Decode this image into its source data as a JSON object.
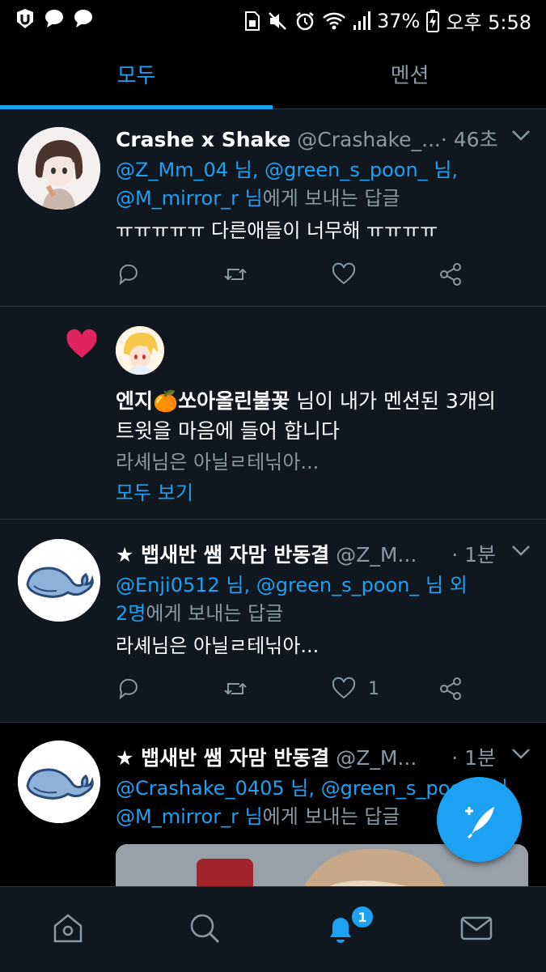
{
  "status_bar": {
    "battery": "37%",
    "time": "오후 5:58"
  },
  "tabs": [
    {
      "label": "모두"
    },
    {
      "label": "멘션"
    }
  ],
  "tweets": [
    {
      "name": "Crashe x Shake",
      "handle": "@Crashake_...",
      "time": "· 46초",
      "reply_to": {
        "line1": "@Z_Mm_04 님, @green_s_poon_ 님,",
        "line2_mention": "@M_mirror_r 님",
        "line2_rest": "에게 보내는 답글"
      },
      "text": "ㅠㅠㅠㅠㅠ 다른애들이 너무해 ㅠㅠㅠㅠ",
      "like_count": ""
    },
    {
      "name": "★ 뱁새반 쌤 자맘 반동결",
      "handle": "@Z_M...",
      "time": "· 1분",
      "reply_to": {
        "line1": "@Enji0512 님, @green_s_poon_ 님 외",
        "line2_mention": "2명",
        "line2_rest": "에게 보내는 답글"
      },
      "text": "라셰님은 아닐ㄹ테닊아...",
      "like_count": "1"
    },
    {
      "name": "★ 뱁새반 쌤 자맘 반동결",
      "handle": "@Z_M...",
      "time": "· 1분",
      "reply_to": {
        "line1": "@Crashake_0405 님, @green_s_poon_ 님,",
        "line2_mention": "@M_mirror_r 님",
        "line2_rest": "에게 보내는 답글"
      }
    }
  ],
  "like_notification": {
    "user": "엔지🍊쏘아올린불꽃",
    "text_rest": " 님이 내가 멘션된 3개의",
    "text_line2": "트윗을 마음에 들어 합니다",
    "preview": "라셰님은 아닐ㄹ테닊아...",
    "show_all": "모두 보기"
  },
  "bottom_nav": {
    "notifications_badge": "1"
  },
  "colors": {
    "accent": "#1da1f2",
    "background": "#10171e",
    "like": "#e0245e"
  }
}
